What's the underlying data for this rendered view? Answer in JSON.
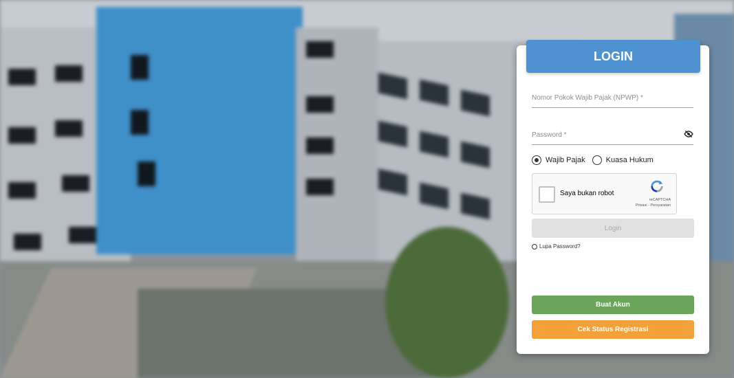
{
  "login": {
    "title": "LOGIN",
    "npwp_placeholder": "Nomor Pokok Wajib Pajak (NPWP) *",
    "password_placeholder": "Password *",
    "radio_options": [
      {
        "label": "Wajib Pajak",
        "selected": true
      },
      {
        "label": "Kuasa Hukum",
        "selected": false
      }
    ],
    "captcha": {
      "label": "Saya bukan robot",
      "brand": "reCAPTCHA",
      "links": "Privasi - Persyaratan"
    },
    "login_button": "Login",
    "forgot_password": "Lupa Password?",
    "create_account_button": "Buat Akun",
    "registration_status_button": "Cek Status Registrasi"
  },
  "colors": {
    "header": "#4f92d2",
    "create_account": "#6aa55b",
    "registration_status": "#f1a03a",
    "login_disabled": "#e1e1e1"
  },
  "icons": [
    "eye-slash-icon",
    "recaptcha-logo-icon",
    "info-icon"
  ]
}
